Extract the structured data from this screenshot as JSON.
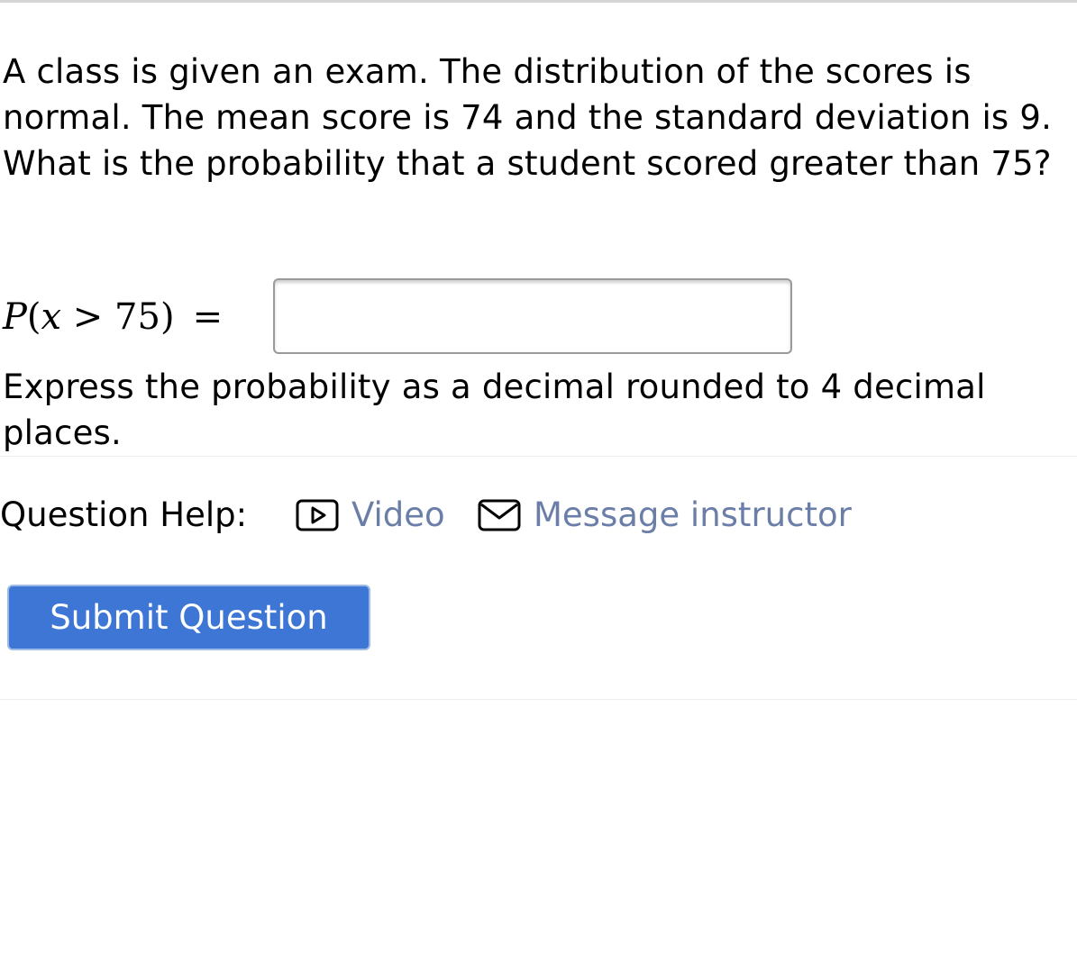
{
  "question": {
    "text": "A class is given an exam. The distribution of the scores is normal. The mean score is 74 and the standard deviation is 9. What is the probability that a student scored greater than 75?"
  },
  "answer": {
    "expression_p": "P",
    "expression_open": "(",
    "expression_var": "x",
    "expression_op": " > ",
    "expression_num": "75",
    "expression_close": ")",
    "expression_eq": "=",
    "input_value": ""
  },
  "instruction": {
    "text": "Express the probability as a decimal rounded to 4 decimal places."
  },
  "help": {
    "label": "Question Help:",
    "video_label": "Video",
    "message_label": "Message instructor",
    "link_color": "#6b7ea8"
  },
  "submit": {
    "label": "Submit Question",
    "color": "#3d76d4"
  }
}
